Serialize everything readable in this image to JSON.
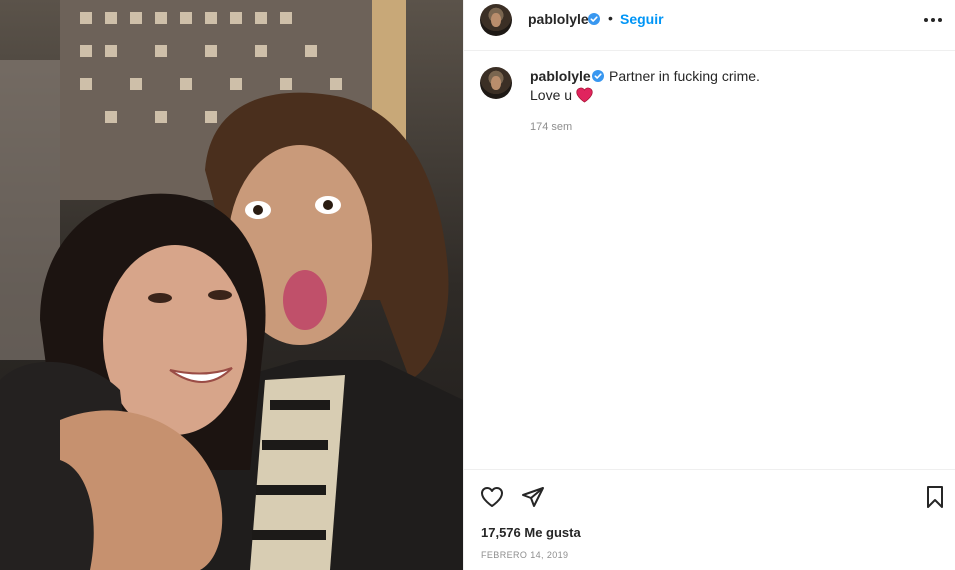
{
  "header": {
    "username": "pablolyle",
    "separator": "•",
    "follow_label": "Seguir",
    "avatar_icon": "avatar-icon",
    "verified_icon": "verified-badge-icon",
    "more_icon": "more-options-icon"
  },
  "caption": {
    "username": "pablolyle",
    "text_line1": "Partner in fucking crime.",
    "text_line2": "Love u",
    "emoji_icon": "red-heart-icon",
    "time_ago": "174 sem"
  },
  "actions": {
    "like_icon": "heart-outline-icon",
    "share_icon": "paper-plane-icon",
    "save_icon": "bookmark-icon",
    "likes_count": "17,576 Me gusta",
    "date": "FEBRERO 14, 2019"
  },
  "colors": {
    "follow_blue": "#0095f6",
    "verified_blue": "#3897f0",
    "heart_red": "#ed4956",
    "muted_text": "#8e8e8e"
  }
}
